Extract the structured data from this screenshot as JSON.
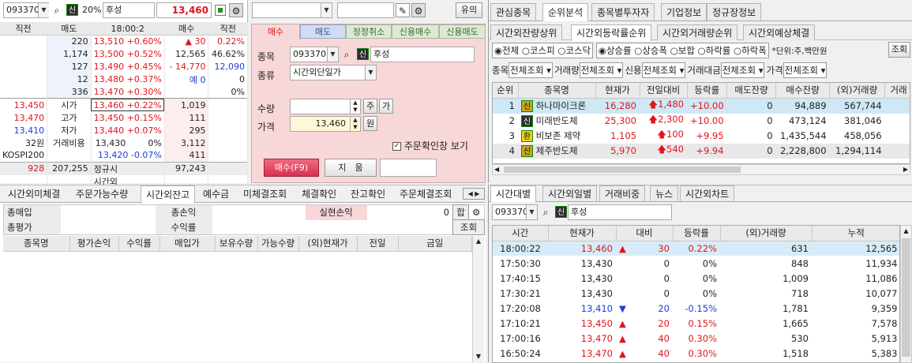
{
  "left": {
    "code": "093370",
    "badge": "신",
    "margin": "20%",
    "name": "후성",
    "price": "13,460",
    "ob_headers": [
      "직전",
      "매도",
      "18:00:2",
      "매수",
      "직전"
    ],
    "asks": [
      {
        "prev": "",
        "qty": "220",
        "price": "13,510",
        "pct": "+0.60%",
        "bq": "▲ 30",
        "bprev": "0.22%"
      },
      {
        "prev": "",
        "qty": "1,174",
        "price": "13,500",
        "pct": "+0.52%",
        "bq": "12,565",
        "bprev": "46.62%"
      },
      {
        "prev": "",
        "qty": "127",
        "price": "13,490",
        "pct": "+0.45%",
        "bq": "- 14,770",
        "bprev": "12,090"
      },
      {
        "prev": "",
        "qty": "12",
        "price": "13,480",
        "pct": "+0.37%",
        "bq": "예 0",
        "bprev": "0"
      },
      {
        "prev": "",
        "qty": "336",
        "price": "13,470",
        "pct": "+0.30%",
        "bq": "",
        "bprev": "0%"
      }
    ],
    "bids": [
      {
        "prev": "13,450",
        "label": "시가",
        "price": "13,460",
        "pct": "+0.22%",
        "bq": "1,019"
      },
      {
        "prev": "13,470",
        "label": "고가",
        "price": "13,450",
        "pct": "+0.15%",
        "bq": "111"
      },
      {
        "prev": "13,410",
        "label": "저가",
        "price": "13,440",
        "pct": "+0.07%",
        "bq": "295"
      },
      {
        "prev": "32원",
        "label": "거래비용",
        "price": "13,430",
        "pct": "0%",
        "bq": "3,112"
      },
      {
        "prev": "KOSPI200",
        "label": "",
        "price": "13,420",
        "pct": "-0.07%",
        "bq": "411"
      }
    ],
    "total": {
      "prev": "928",
      "ask": "207,255",
      "label": "정규시",
      "bid": "97,243"
    },
    "after_label": "시간외"
  },
  "order": {
    "tabs": [
      "매수",
      "매도",
      "정정취소",
      "신용매수",
      "신용매도"
    ],
    "code_label": "종목",
    "code": "093370",
    "name": "후성",
    "type_label": "종류",
    "type": "시간외단일가",
    "qty_label": "수량",
    "qty": "",
    "qty_btn1": "주",
    "qty_btn2": "가",
    "price_label": "가격",
    "price": "13,460",
    "price_unit": "원",
    "confirm": "주문확인창 보기",
    "buy_btn": "매수(F9)",
    "clear_btn": "지　움",
    "top_btn": "유의"
  },
  "acct": {
    "tabs": [
      "시간외미체결",
      "주문가능수량",
      "시간외잔고",
      "예수금",
      "미체결조회",
      "체결확인",
      "잔고확인",
      "주문체결조회"
    ],
    "r1": [
      "총매입",
      "총손익",
      "실현손익",
      "0",
      "합"
    ],
    "r2": [
      "총평가",
      "수익률",
      "조회"
    ],
    "headers": [
      "종목명",
      "평가손익",
      "수익률",
      "매입가",
      "보유수량",
      "가능수량",
      "(외)현재가",
      "전일",
      "금일"
    ]
  },
  "rank": {
    "tabs": [
      "관심종목",
      "순위분석",
      "종목별투자자",
      "기업정보",
      "정규장정보"
    ],
    "subtabs": [
      "시간외잔량상위",
      "시간외등락률순위",
      "시간외거래량순위",
      "시간외예상체결"
    ],
    "markets": [
      "전체",
      "코스피",
      "코스닥"
    ],
    "sorts": [
      "상승률",
      "상승폭",
      "보합",
      "하락률",
      "하락폭"
    ],
    "unit": "*단위:주,백만원",
    "query": "조회",
    "filters": [
      [
        "종목",
        "전체조회"
      ],
      [
        "거래량",
        "전체조회"
      ],
      [
        "신용",
        "전체조회"
      ],
      [
        "거래대금",
        "전체조회"
      ],
      [
        "가격",
        "전체조회"
      ]
    ],
    "headers": [
      "순위",
      "종목명",
      "현재가",
      "전일대비",
      "등락률",
      "매도잔량",
      "매수잔량",
      "(외)거래량",
      "거래"
    ],
    "rows": [
      {
        "rank": "1",
        "badge": "신",
        "name": "하나마이크론",
        "price": "16,280",
        "chg": "1,480",
        "pct": "+10.00",
        "ask": "0",
        "bid": "94,889",
        "vol": "567,744"
      },
      {
        "rank": "2",
        "badge": "신",
        "name": "미래반도체",
        "price": "25,300",
        "chg": "2,300",
        "pct": "+10.00",
        "ask": "0",
        "bid": "473,124",
        "vol": "381,046"
      },
      {
        "rank": "3",
        "badge": "환",
        "name": "비보존 제약",
        "price": "1,105",
        "chg": "100",
        "pct": "+9.95",
        "ask": "0",
        "bid": "1,435,544",
        "vol": "458,056"
      },
      {
        "rank": "4",
        "badge": "신",
        "name": "제주반도체",
        "price": "5,970",
        "chg": "540",
        "pct": "+9.94",
        "ask": "0",
        "bid": "2,228,800",
        "vol": "1,294,114"
      }
    ]
  },
  "ticks": {
    "tabs": [
      "시간대별",
      "시간외일별",
      "거래비중",
      "뉴스",
      "시간외차트"
    ],
    "code": "093370",
    "badge": "신",
    "name": "후성",
    "headers": [
      "시간",
      "현재가",
      "대비",
      "등락률",
      "(외)거래량",
      "누적"
    ],
    "rows": [
      {
        "t": "18:00:22",
        "p": "13,460",
        "d": "30",
        "a": "up",
        "r": "0.22%",
        "v": "631",
        "c": "12,565"
      },
      {
        "t": "17:50:30",
        "p": "13,430",
        "d": "0",
        "a": "",
        "r": "0%",
        "v": "848",
        "c": "11,934"
      },
      {
        "t": "17:40:15",
        "p": "13,430",
        "d": "0",
        "a": "",
        "r": "0%",
        "v": "1,009",
        "c": "11,086"
      },
      {
        "t": "17:30:21",
        "p": "13,430",
        "d": "0",
        "a": "",
        "r": "0%",
        "v": "718",
        "c": "10,077"
      },
      {
        "t": "17:20:08",
        "p": "13,410",
        "d": "20",
        "a": "dn",
        "r": "-0.15%",
        "v": "1,781",
        "c": "9,359"
      },
      {
        "t": "17:10:21",
        "p": "13,450",
        "d": "20",
        "a": "up",
        "r": "0.15%",
        "v": "1,665",
        "c": "7,578"
      },
      {
        "t": "17:00:16",
        "p": "13,470",
        "d": "40",
        "a": "up",
        "r": "0.30%",
        "v": "530",
        "c": "5,913"
      },
      {
        "t": "16:50:24",
        "p": "13,470",
        "d": "40",
        "a": "up",
        "r": "0.30%",
        "v": "1,518",
        "c": "5,383"
      }
    ]
  }
}
